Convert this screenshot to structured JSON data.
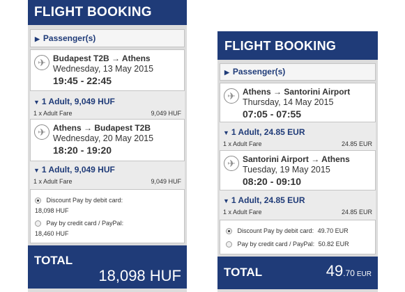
{
  "widget1": {
    "header": "FLIGHT BOOKING",
    "passengers_label": "Passenger(s)",
    "flights": [
      {
        "route": "Budapest T2B → Athens",
        "date": "Wednesday, 13 May 2015",
        "times": "19:45 - 22:45",
        "fare_summary": "1 Adult, 9,049 HUF",
        "fare_type": "1 x Adult Fare",
        "fare_amount": "9,049 HUF"
      },
      {
        "route": "Athens → Budapest T2B",
        "date": "Wednesday, 20 May 2015",
        "times": "18:20 - 19:20",
        "fare_summary": "1 Adult, 9,049 HUF",
        "fare_type": "1 x Adult Fare",
        "fare_amount": "9,049 HUF"
      }
    ],
    "payment": [
      {
        "label": "Discount Pay by debit card:",
        "amount": "18,098 HUF",
        "selected": true
      },
      {
        "label": "Pay by credit card / PayPal:",
        "amount": "18,460 HUF",
        "selected": false
      }
    ],
    "total_label": "TOTAL",
    "total_value": "18,098 HUF"
  },
  "widget2": {
    "header": "FLIGHT BOOKING",
    "passengers_label": "Passenger(s)",
    "flights": [
      {
        "route": "Athens → Santorini Airport",
        "date": "Thursday, 14 May 2015",
        "times": "07:05 - 07:55",
        "fare_summary": "1 Adult, 24.85 EUR",
        "fare_type": "1 x Adult Fare",
        "fare_amount": "24.85 EUR"
      },
      {
        "route": "Santorini Airport → Athens",
        "date": "Tuesday, 19 May 2015",
        "times": "08:20 - 09:10",
        "fare_summary": "1 Adult, 24.85 EUR",
        "fare_type": "1 x Adult Fare",
        "fare_amount": "24.85 EUR"
      }
    ],
    "payment": [
      {
        "label": "Discount Pay by debit card:",
        "amount": "49.70 EUR",
        "selected": true
      },
      {
        "label": "Pay by credit card / PayPal:",
        "amount": "50.82 EUR",
        "selected": false
      }
    ],
    "total_label": "TOTAL",
    "total_int": "49",
    "total_dec": ".70",
    "total_currency": "EUR"
  },
  "icons": {
    "expand": "triangle-right-icon",
    "collapse": "triangle-down-icon",
    "flight": "airplane-icon",
    "radio": "radio-button-icon"
  },
  "colors": {
    "brand_navy": "#1f3b78",
    "panel_grey": "#dcdcdc",
    "fare_grey": "#ebebeb"
  }
}
